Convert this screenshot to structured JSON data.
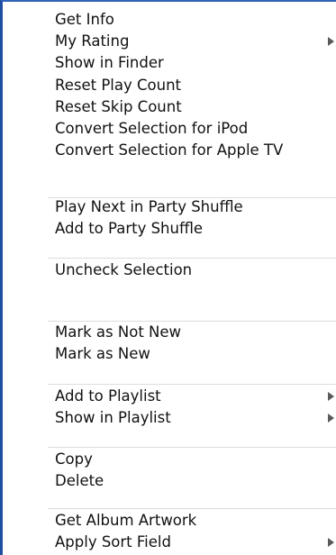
{
  "menu": {
    "groups": [
      {
        "items": [
          {
            "label": "Get Info",
            "submenu": false
          },
          {
            "label": "My Rating",
            "submenu": true
          },
          {
            "label": "Show in Finder",
            "submenu": false
          },
          {
            "label": "Reset Play Count",
            "submenu": false
          },
          {
            "label": "Reset Skip Count",
            "submenu": false
          },
          {
            "label": "Convert Selection for iPod",
            "submenu": false
          },
          {
            "label": "Convert Selection for Apple TV",
            "submenu": false
          }
        ]
      },
      {
        "items": [
          {
            "label": "Play Next in Party Shuffle",
            "submenu": false
          },
          {
            "label": "Add to Party Shuffle",
            "submenu": false
          }
        ]
      },
      {
        "items": [
          {
            "label": "Uncheck Selection",
            "submenu": false
          }
        ]
      },
      {
        "items": [
          {
            "label": "Mark as Not New",
            "submenu": false
          },
          {
            "label": "Mark as New",
            "submenu": false
          }
        ]
      },
      {
        "items": [
          {
            "label": "Add to Playlist",
            "submenu": true
          },
          {
            "label": "Show in Playlist",
            "submenu": true
          }
        ]
      },
      {
        "items": [
          {
            "label": "Copy",
            "submenu": false
          },
          {
            "label": "Delete",
            "submenu": false
          }
        ]
      },
      {
        "items": [
          {
            "label": "Get Album Artwork",
            "submenu": false
          },
          {
            "label": "Apply Sort Field",
            "submenu": true
          }
        ]
      }
    ]
  }
}
